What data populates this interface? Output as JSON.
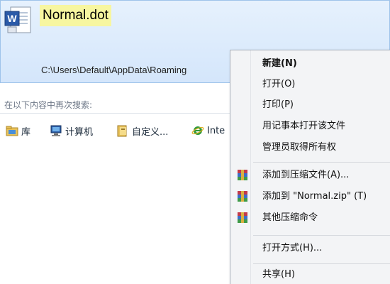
{
  "result": {
    "title": "Normal.dot",
    "path": "C:\\Users\\Default\\AppData\\Roaming"
  },
  "search_again": {
    "label": "在以下内容中再次搜索:",
    "locations": [
      {
        "label": "库",
        "icon": "library-icon"
      },
      {
        "label": "计算机",
        "icon": "computer-icon"
      },
      {
        "label": "自定义...",
        "icon": "custom-folder-icon"
      },
      {
        "label": "Inte",
        "icon": "internet-explorer-icon"
      }
    ]
  },
  "context_menu": {
    "items": [
      {
        "label": "新建(N)",
        "bold": true
      },
      {
        "label": "打开(O)"
      },
      {
        "label": "打印(P)"
      },
      {
        "label": "用记事本打开该文件"
      },
      {
        "label": "管理员取得所有权"
      },
      {
        "label": "添加到压缩文件(A)...",
        "icon": "winrar-icon"
      },
      {
        "label": "添加到 \"Normal.zip\" (T)",
        "icon": "winrar-icon"
      },
      {
        "label": "其他压缩命令",
        "icon": "winrar-icon"
      },
      {
        "label": "打开方式(H)..."
      },
      {
        "label": "共享(H)"
      }
    ]
  }
}
